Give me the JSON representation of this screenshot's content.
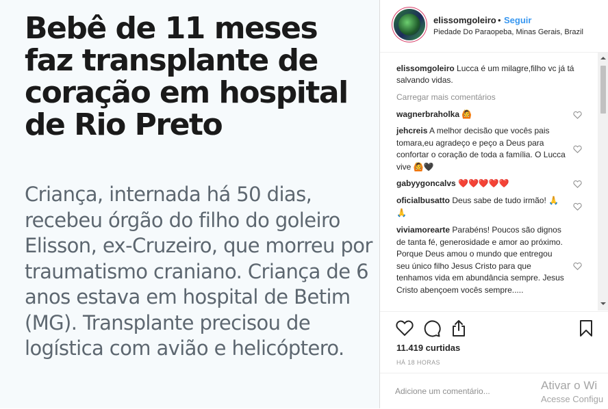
{
  "article": {
    "headline": "Bebê de 11 meses faz transplante de coração em hospital de Rio Preto",
    "summary": "Criança, internada há 50 dias, recebeu órgão do filho do goleiro Elisson, ex-Cruzeiro, que morreu por traumatismo craniano. Criança de 6 anos estava em hospital de Betim (MG). Transplante precisou de logística com avião e helicóptero."
  },
  "post": {
    "username": "elissomgoleiro",
    "separator": "•",
    "follow_label": "Seguir",
    "location": "Piedade Do Paraopeba, Minas Gerais, Brazil",
    "caption_user": "elissomgoleiro",
    "caption_text": "Lucca é um milagre,filho vc já tá salvando vidas.",
    "load_more_label": "Carregar mais comentários",
    "likes": "11.419 curtidas",
    "time": "HÁ 18 HORAS",
    "add_comment_placeholder": "Adicione um comentário..."
  },
  "comments": [
    {
      "user": "wagnerbraholka",
      "text": "🙆"
    },
    {
      "user": "jehcreis",
      "text": "A melhor decisão que vocês pais tomara,eu agradeço e peço a Deus para confortar o coração de toda a família. O Lucca vive 🙆🖤"
    },
    {
      "user": "gabyygoncalvs",
      "text": "❤️❤️❤️❤️❤️"
    },
    {
      "user": "oficialbusatto",
      "text": "Deus sabe de tudo irmão! 🙏🙏"
    },
    {
      "user": "viviamorearte",
      "text": "Parabéns! Poucos são dignos de tanta fé, generosidade e amor ao próximo. Porque Deus amou o mundo que entregou seu único filho Jesus Cristo para que tenhamos vida em abundância sempre. Jesus Cristo abençoem vocês sempre....."
    }
  ],
  "watermark": {
    "line1": "Ativar o Wi",
    "line2": "Acesse Configu"
  },
  "icons": [
    "heart-icon",
    "comment-icon",
    "share-icon",
    "bookmark-icon",
    "small-heart-icon"
  ],
  "colors": {
    "link": "#3897f0",
    "text": "#262626",
    "muted": "#8e8e8e",
    "heart_red": "#c8102e"
  }
}
